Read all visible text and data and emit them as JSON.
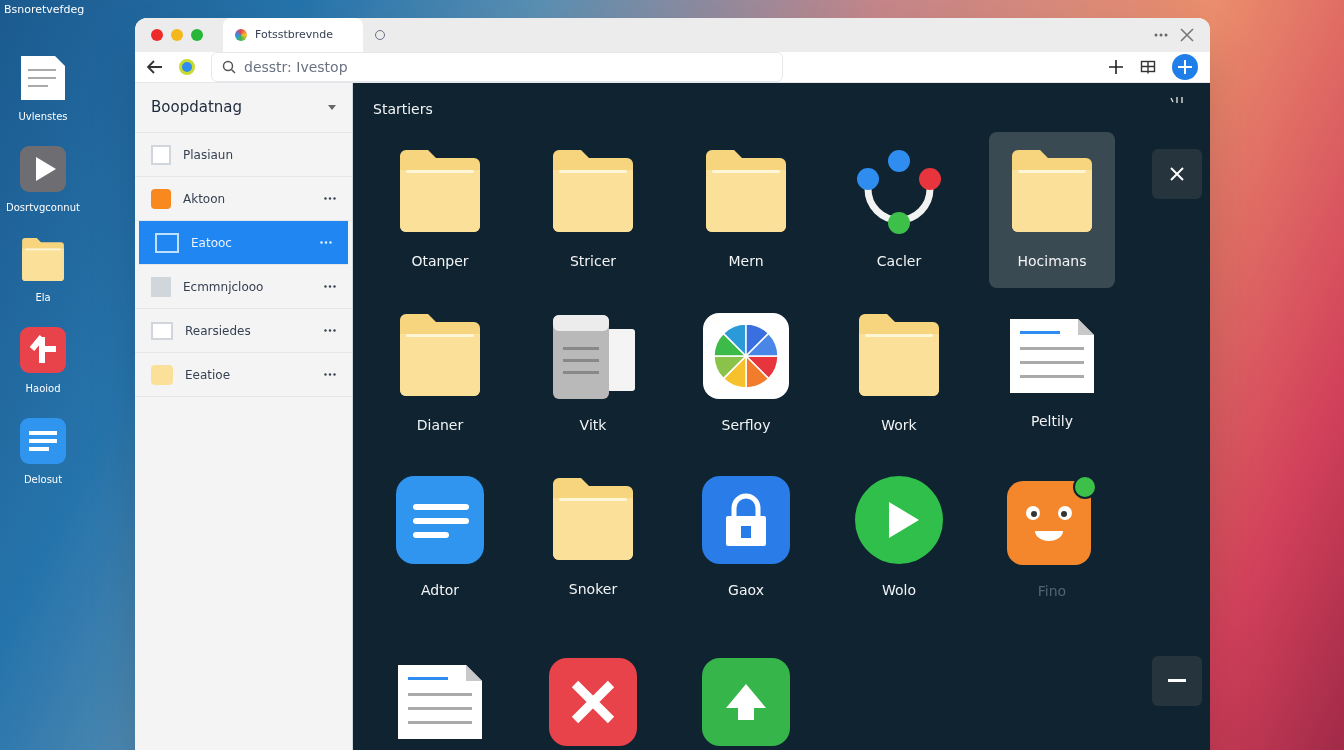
{
  "desktop": {
    "caption": "Bsnoretvefdeg",
    "icons": [
      {
        "kind": "document",
        "label": "Uvlenstes"
      },
      {
        "kind": "play",
        "label": "Dosrtvgconnut"
      },
      {
        "kind": "folder",
        "label": "Ela"
      },
      {
        "kind": "arrow",
        "label": "Haoiod"
      },
      {
        "kind": "list",
        "label": "Delosut"
      }
    ]
  },
  "browser": {
    "tab": {
      "title": "Fotsstbrevnde"
    },
    "address": {
      "value": "desstr: Ivestop"
    }
  },
  "sidebar": {
    "title": "Boopdatnag",
    "items": [
      {
        "kind": "page",
        "label": "Plasiaun",
        "selected": false,
        "more": false
      },
      {
        "kind": "orange",
        "label": "Aktoon",
        "selected": false,
        "more": true
      },
      {
        "kind": "window",
        "label": "Eatooc",
        "selected": true,
        "more": true
      },
      {
        "kind": "grey",
        "label": "Ecmmnjclooo",
        "selected": false,
        "more": true
      },
      {
        "kind": "blank",
        "label": "Rearsiedes",
        "selected": false,
        "more": true
      },
      {
        "kind": "folder",
        "label": "Eeatioe",
        "selected": false,
        "more": true
      }
    ]
  },
  "main": {
    "title": "Startiers",
    "items": [
      {
        "kind": "folder",
        "label": "Otanper",
        "selected": false,
        "dimmed": false
      },
      {
        "kind": "folder",
        "label": "Stricer",
        "selected": false,
        "dimmed": false
      },
      {
        "kind": "folder",
        "label": "Mern",
        "selected": false,
        "dimmed": false
      },
      {
        "kind": "nodes",
        "label": "Cacler",
        "selected": false,
        "dimmed": false
      },
      {
        "kind": "folder",
        "label": "Hocimans",
        "selected": true,
        "dimmed": false
      },
      {
        "kind": "folder",
        "label": "Dianer",
        "selected": false,
        "dimmed": false
      },
      {
        "kind": "files",
        "label": "Vitk",
        "selected": false,
        "dimmed": false
      },
      {
        "kind": "pinwheel",
        "label": "Serfloy",
        "selected": false,
        "dimmed": false
      },
      {
        "kind": "folder",
        "label": "Work",
        "selected": false,
        "dimmed": false
      },
      {
        "kind": "document",
        "label": "Peltily",
        "selected": false,
        "dimmed": false
      },
      {
        "kind": "notes",
        "label": "Adtor",
        "selected": false,
        "dimmed": false
      },
      {
        "kind": "folder",
        "label": "Snoker",
        "selected": false,
        "dimmed": false
      },
      {
        "kind": "lock",
        "label": "Gaox",
        "selected": false,
        "dimmed": false
      },
      {
        "kind": "play",
        "label": "Wolo",
        "selected": false,
        "dimmed": false
      },
      {
        "kind": "face",
        "label": "Fino",
        "selected": false,
        "dimmed": true
      },
      {
        "kind": "document",
        "selected": false,
        "dimmed": false
      },
      {
        "kind": "cross",
        "selected": false,
        "dimmed": false
      },
      {
        "kind": "up",
        "selected": false,
        "dimmed": false
      }
    ]
  }
}
